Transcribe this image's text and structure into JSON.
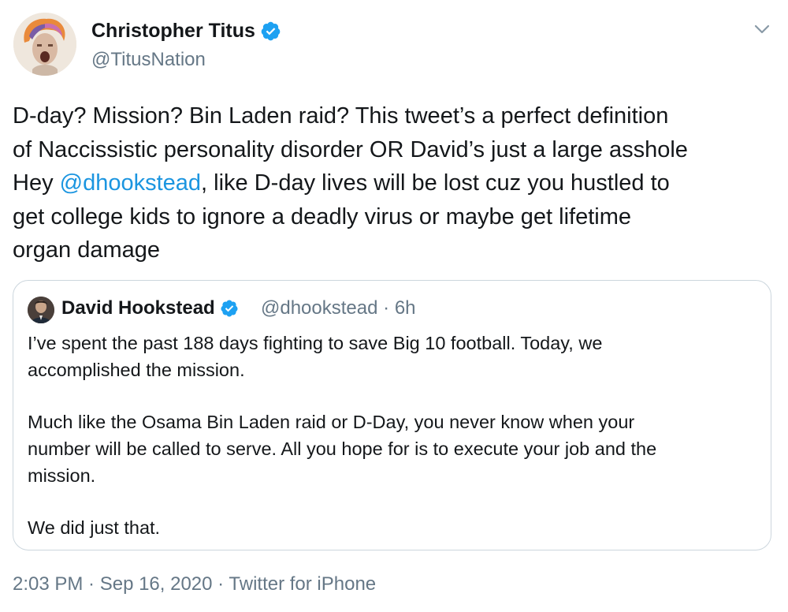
{
  "tweet": {
    "author": {
      "name": "Christopher Titus",
      "handle": "@TitusNation",
      "verified": true,
      "avatar_icon": "profile-photo-icon"
    },
    "body_lines": [
      "D-day? Mission? Bin Laden raid? This tweet’s a perfect definition",
      "of Naccissistic personality disorder OR David’s just a large asshole",
      {
        "before": "Hey ",
        "mention": "@dhookstead",
        "after": ", like D-day lives will be lost cuz you hustled to"
      },
      "get college kids to ignore a deadly virus or maybe get lifetime",
      "organ damage"
    ],
    "quoted": {
      "name": "David Hookstead",
      "handle": "@dhookstead",
      "separator": "·",
      "age": "6h",
      "verified": true,
      "paragraphs": [
        [
          "I’ve spent the past 188 days fighting to save Big 10 football. Today, we",
          "accomplished the mission."
        ],
        [
          "Much like the Osama Bin Laden raid or D-Day, you never know when your",
          "number will be called to serve. All you hope for is to execute your job and the",
          "mission."
        ],
        [
          "We did just that."
        ]
      ]
    },
    "timestamp": "2:03 PM · Sep 16, 2020",
    "separator": "·",
    "source": "Twitter for iPhone"
  },
  "colors": {
    "text": "#14171a",
    "secondary": "#657786",
    "link": "#1b95e0",
    "verified": "#1da1f2",
    "border": "#ccd6dd"
  },
  "icons": [
    "verified-badge-icon",
    "chevron-down-icon"
  ]
}
